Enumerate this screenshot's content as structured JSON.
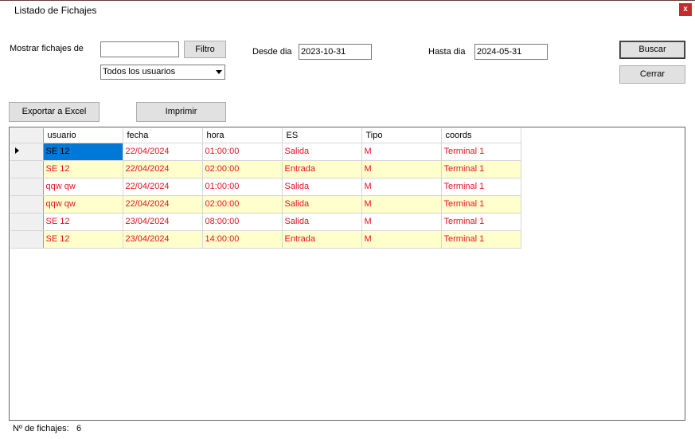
{
  "window": {
    "title": "Listado de Fichajes",
    "close_label": "x"
  },
  "filters": {
    "mostrar_label": "Mostrar fichajes de",
    "mostrar_value": "",
    "filtro_button": "Filtro",
    "user_select": "Todos los usuarios",
    "desde_label": "Desde dia",
    "desde_value": "2023-10-31",
    "hasta_label": "Hasta dia",
    "hasta_value": "2024-05-31"
  },
  "actions": {
    "buscar": "Buscar",
    "cerrar": "Cerrar",
    "exportar": "Exportar a Excel",
    "imprimir": "Imprimir"
  },
  "grid": {
    "columns": [
      "usuario",
      "fecha",
      "hora",
      "ES",
      "Tipo",
      "coords"
    ],
    "rows": [
      {
        "usuario": "SE 12",
        "fecha": "22/04/2024",
        "hora": "01:00:00",
        "ES": "Salida",
        "Tipo": "M",
        "coords": "Terminal 1"
      },
      {
        "usuario": "SE 12",
        "fecha": "22/04/2024",
        "hora": "02:00:00",
        "ES": "Entrada",
        "Tipo": "M",
        "coords": "Terminal 1"
      },
      {
        "usuario": "qqw qw",
        "fecha": "22/04/2024",
        "hora": "01:00:00",
        "ES": "Salida",
        "Tipo": "M",
        "coords": "Terminal 1"
      },
      {
        "usuario": "qqw qw",
        "fecha": "22/04/2024",
        "hora": "02:00:00",
        "ES": "Salida",
        "Tipo": "M",
        "coords": "Terminal 1"
      },
      {
        "usuario": "SE 12",
        "fecha": "23/04/2024",
        "hora": "08:00:00",
        "ES": "Salida",
        "Tipo": "M",
        "coords": "Terminal 1"
      },
      {
        "usuario": "SE 12",
        "fecha": "23/04/2024",
        "hora": "14:00:00",
        "ES": "Entrada",
        "Tipo": "M",
        "coords": "Terminal 1"
      }
    ]
  },
  "footer": {
    "count_label": "Nº de fichajes:",
    "count_value": "6"
  },
  "colors": {
    "row_text": "#e81123",
    "alt_row_bg": "#ffffcc",
    "selection": "#0078d7",
    "close_bg": "#c42b2b"
  }
}
